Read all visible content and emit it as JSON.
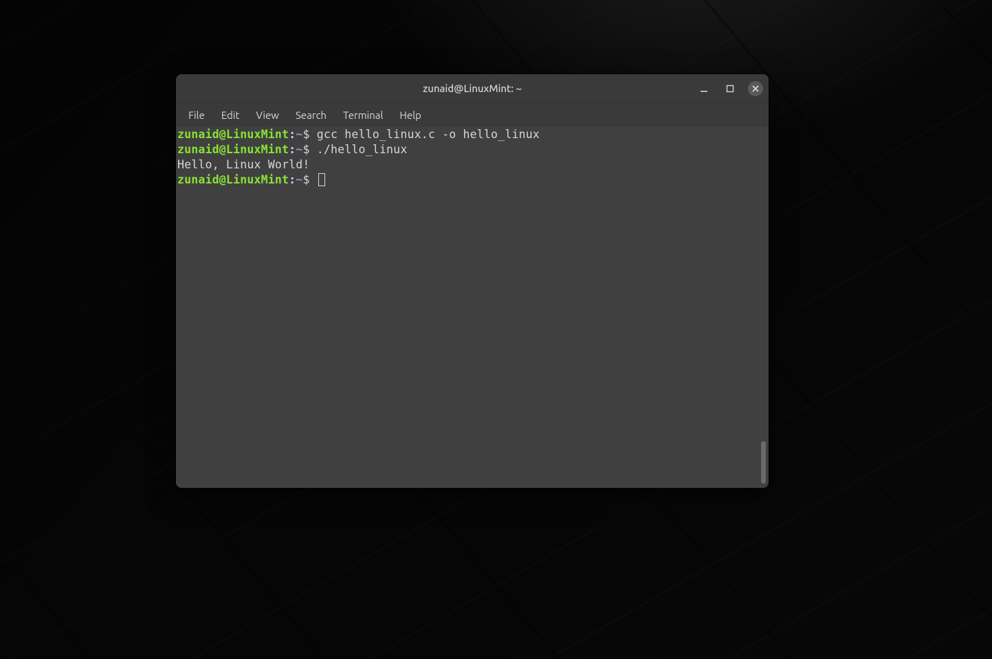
{
  "window": {
    "title": "zunaid@LinuxMint: ~"
  },
  "menubar": {
    "items": [
      "File",
      "Edit",
      "View",
      "Search",
      "Terminal",
      "Help"
    ]
  },
  "terminal": {
    "lines": [
      {
        "type": "prompt",
        "user": "zunaid@LinuxMint",
        "path": "~",
        "symbol": "$",
        "command": "gcc hello_linux.c -o hello_linux"
      },
      {
        "type": "prompt",
        "user": "zunaid@LinuxMint",
        "path": "~",
        "symbol": "$",
        "command": "./hello_linux"
      },
      {
        "type": "output",
        "text": "Hello, Linux World!"
      },
      {
        "type": "prompt",
        "user": "zunaid@LinuxMint",
        "path": "~",
        "symbol": "$",
        "command": "",
        "cursor": true
      }
    ]
  },
  "colors": {
    "prompt_user": "#8ae234",
    "prompt_path": "#729fcf",
    "terminal_bg": "#404040",
    "chrome_bg": "#3a3a3a",
    "text": "#d6d6d6"
  }
}
